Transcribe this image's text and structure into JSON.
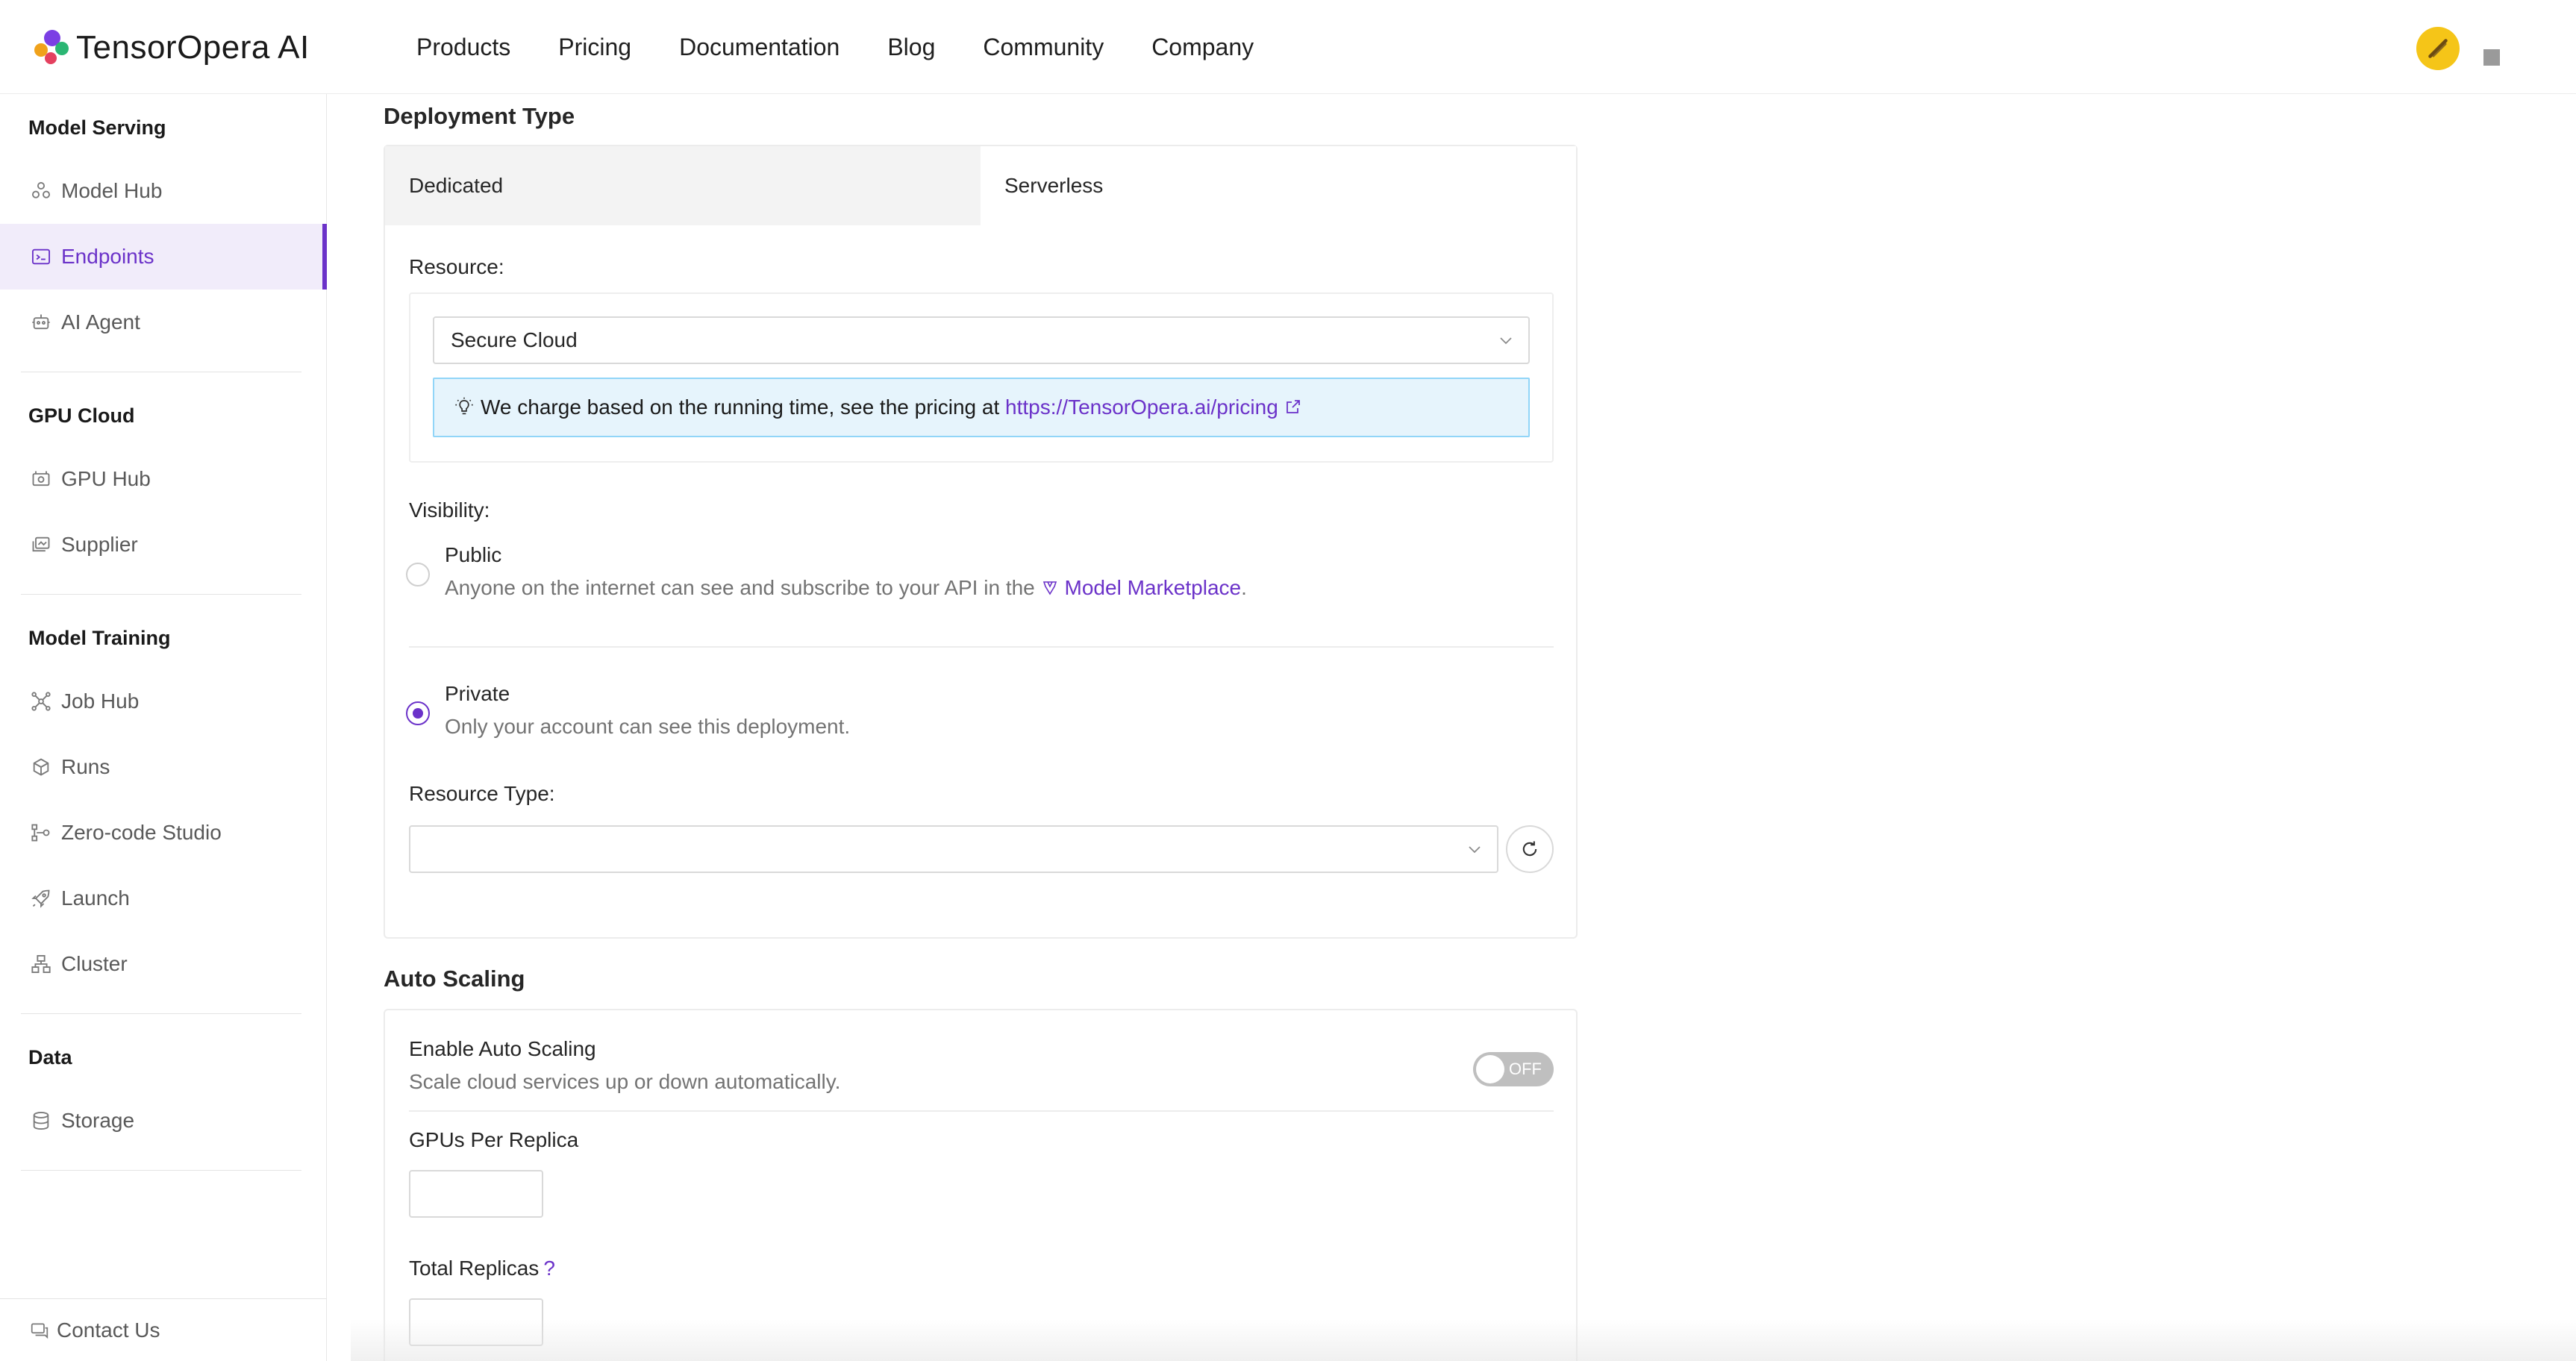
{
  "brand": {
    "name": "TensorOpera AI"
  },
  "topnav": {
    "items": [
      "Products",
      "Pricing",
      "Documentation",
      "Blog",
      "Community",
      "Company"
    ]
  },
  "sidebar": {
    "sections": [
      {
        "title": "Model Serving",
        "items": [
          {
            "label": "Model Hub",
            "icon": "model-hub-icon",
            "active": false
          },
          {
            "label": "Endpoints",
            "icon": "endpoints-icon",
            "active": true
          },
          {
            "label": "AI Agent",
            "icon": "robot-icon",
            "active": false
          }
        ]
      },
      {
        "title": "GPU Cloud",
        "items": [
          {
            "label": "GPU Hub",
            "icon": "gpu-icon",
            "active": false
          },
          {
            "label": "Supplier",
            "icon": "supplier-icon",
            "active": false
          }
        ]
      },
      {
        "title": "Model Training",
        "items": [
          {
            "label": "Job Hub",
            "icon": "job-hub-icon",
            "active": false
          },
          {
            "label": "Runs",
            "icon": "runs-icon",
            "active": false
          },
          {
            "label": "Zero-code Studio",
            "icon": "studio-icon",
            "active": false
          },
          {
            "label": "Launch",
            "icon": "rocket-icon",
            "active": false
          },
          {
            "label": "Cluster",
            "icon": "cluster-icon",
            "active": false
          }
        ]
      },
      {
        "title": "Data",
        "items": [
          {
            "label": "Storage",
            "icon": "storage-icon",
            "active": false
          }
        ]
      }
    ],
    "footer": {
      "label": "Contact Us",
      "icon": "chat-icon"
    }
  },
  "deployment": {
    "title": "Deployment Type",
    "tabs": [
      {
        "label": "Dedicated",
        "selected": false
      },
      {
        "label": "Serverless",
        "selected": true
      }
    ],
    "resource_label": "Resource:",
    "resource_value": "Secure Cloud",
    "info_text": "We charge based on the running time, see the pricing at ",
    "info_link": "https://TensorOpera.ai/pricing",
    "visibility_label": "Visibility:",
    "visibility_options": [
      {
        "title": "Public",
        "desc_prefix": "Anyone on the internet can see and subscribe to your API in the ",
        "desc_link": "Model Marketplace",
        "desc_suffix": ".",
        "checked": false
      },
      {
        "title": "Private",
        "desc": "Only your account can see this deployment.",
        "checked": true
      }
    ],
    "resource_type_label": "Resource Type:",
    "resource_type_value": ""
  },
  "auto_scaling": {
    "title": "Auto Scaling",
    "enable_label": "Enable Auto Scaling",
    "enable_desc": "Scale cloud services up or down automatically.",
    "toggle_state": "OFF",
    "gpus_label": "GPUs Per Replica",
    "gpus_value": "",
    "replicas_label": "Total Replicas",
    "replicas_help": "?",
    "replicas_value": ""
  },
  "colors": {
    "accent": "#6b32c9",
    "info_bg": "#e6f4fc",
    "info_border": "#91d5f8"
  }
}
